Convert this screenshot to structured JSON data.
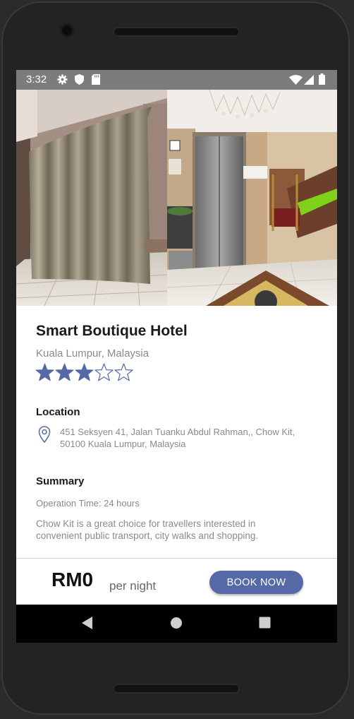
{
  "status_bar": {
    "time": "3:32",
    "icons": [
      "gear-icon",
      "shield-icon",
      "sd-card-icon",
      "wifi-icon",
      "signal-icon",
      "battery-icon"
    ]
  },
  "gallery": {
    "images": [
      "curtained-room-photo",
      "hotel-lobby-elevator-photo"
    ]
  },
  "hotel": {
    "name": "Smart Boutique Hotel",
    "city": "Kuala Lumpur, Malaysia",
    "rating": 3,
    "rating_max": 5
  },
  "location": {
    "heading": "Location",
    "address": "451 Seksyen 41, Jalan Tuanku Abdul Rahman,, Chow Kit, 50100 Kuala Lumpur, Malaysia"
  },
  "summary": {
    "heading": "Summary",
    "operation_time": "Operation Time: 24 hours",
    "text": "Chow Kit is a great choice for travellers interested in convenient public transport, city walks and shopping."
  },
  "booking": {
    "price": "RM0",
    "unit": "per night",
    "button_label": "BOOK NOW"
  },
  "navigation": {
    "icons": [
      "back-icon",
      "home-icon",
      "recents-icon"
    ]
  },
  "colors": {
    "accent": "#5669a7",
    "status_bar": "#7c7c7c",
    "nav_bar": "#000000"
  }
}
